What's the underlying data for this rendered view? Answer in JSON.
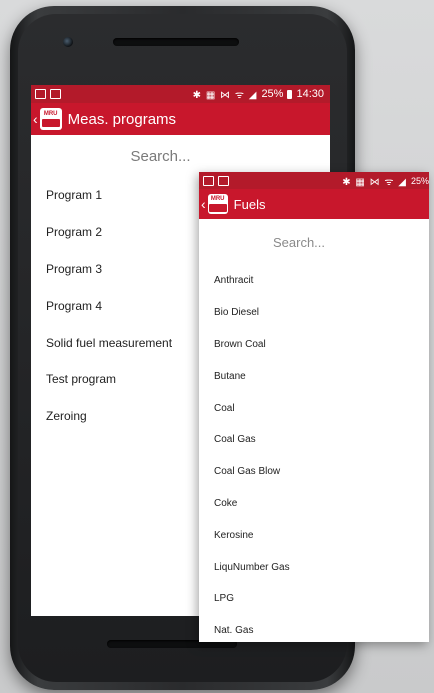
{
  "status_bar": {
    "right_icons": "✱ ▦ ⋈ ᯤ ◢",
    "battery": "25%",
    "time": "14:30"
  },
  "main_screen": {
    "title": "Meas. programs",
    "logo_text": "MRU",
    "search_placeholder": "Search...",
    "programs": [
      "Program 1",
      "Program 2",
      "Program 3",
      "Program 4",
      "Solid fuel measurement",
      "Test program",
      "Zeroing"
    ]
  },
  "fuels_screen": {
    "status_right_icons": "✱ ▦ ⋈ ᯤ ◢",
    "battery": "25%",
    "title": "Fuels",
    "logo_text": "MRU",
    "search_placeholder": "Search...",
    "fuels": [
      "Anthracit",
      "Bio Diesel",
      "Brown Coal",
      "Butane",
      "Coal",
      "Coal Gas",
      "Coal Gas Blow",
      "Coke",
      "Kerosine",
      "LiquNumber Gas",
      "LPG",
      "Nat. Gas"
    ]
  },
  "colors": {
    "appbar": "#c8172c",
    "statusbar": "#b31a2a",
    "background": "#ffffff"
  }
}
